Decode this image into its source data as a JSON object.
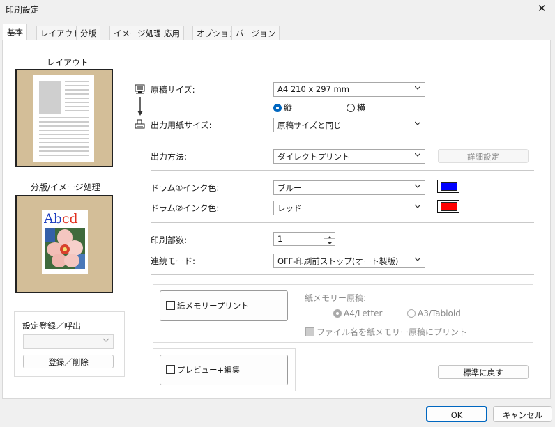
{
  "window": {
    "title": "印刷設定"
  },
  "tabs": [
    "基本",
    "レイアウト",
    "分版",
    "イメージ処理",
    "応用",
    "オプション",
    "バージョン"
  ],
  "left": {
    "layout_caption": "レイアウト",
    "separation_caption": "分版/イメージ処理",
    "sample_text": "Abcd",
    "register": {
      "title": "設定登録／呼出",
      "select_value": "",
      "button": "登録／削除"
    }
  },
  "main": {
    "original_size": {
      "label": "原稿サイズ:",
      "value": "A4 210 x 297 mm"
    },
    "orientation": {
      "portrait": "縦",
      "landscape": "横",
      "selected": "portrait"
    },
    "output_paper_size": {
      "label": "出力用紙サイズ:",
      "value": "原稿サイズと同じ"
    },
    "output_method": {
      "label": "出力方法:",
      "value": "ダイレクトプリント",
      "detail_button": "詳細設定"
    },
    "drum1": {
      "label": "ドラム①インク色:",
      "value": "ブルー",
      "color": "#0000ff"
    },
    "drum2": {
      "label": "ドラム②インク色:",
      "value": "レッド",
      "color": "#ff0000"
    },
    "copies": {
      "label": "印刷部数:",
      "value": "1"
    },
    "continuous_mode": {
      "label": "連続モード:",
      "value": "OFF-印刷前ストップ(オート製版)"
    },
    "paper_memory": {
      "button": "紙メモリープリント",
      "original_label": "紙メモリー原稿:",
      "opt_a4": "A4/Letter",
      "opt_a3": "A3/Tabloid",
      "filename_check": "ファイル名を紙メモリー原稿にプリント"
    },
    "preview": {
      "button": "プレビュー+編集"
    },
    "reset_button": "標準に戻す"
  },
  "footer": {
    "ok": "OK",
    "cancel": "キャンセル"
  },
  "colors": {
    "accent": "#0067c0",
    "thumb_bg": "#d3be98"
  }
}
